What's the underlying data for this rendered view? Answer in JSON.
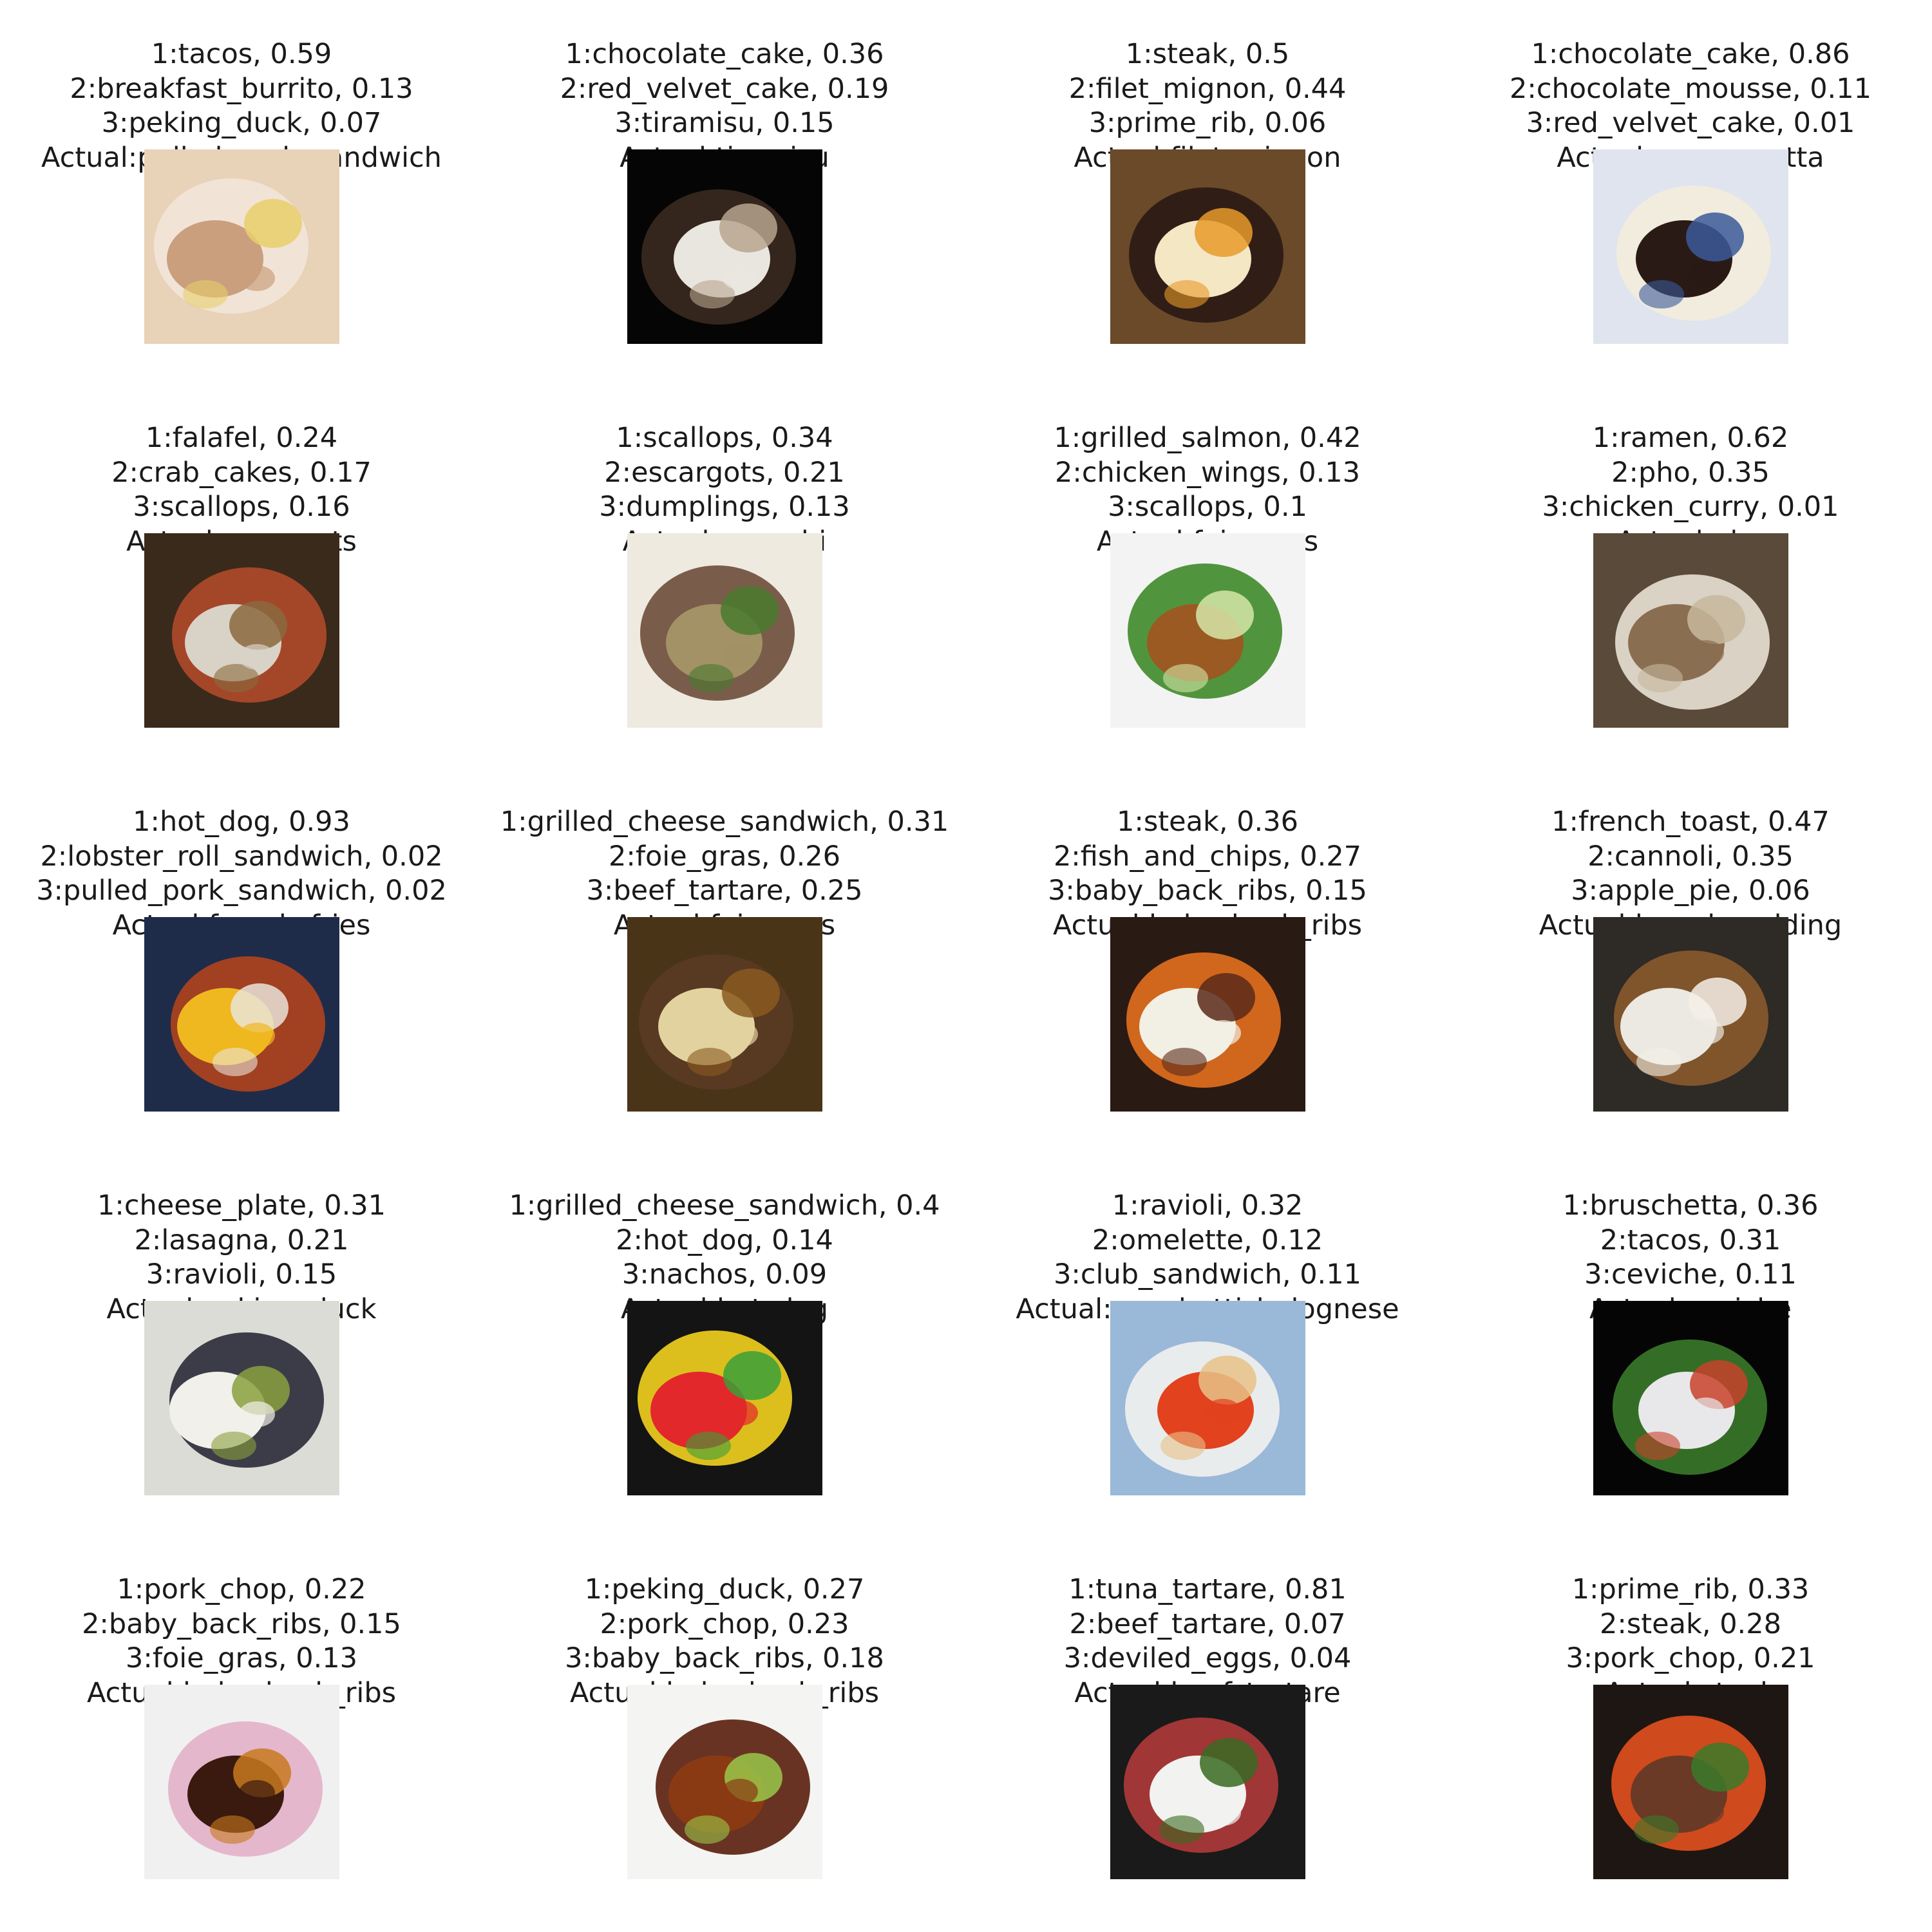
{
  "panels": [
    {
      "l1": "1:tacos, 0.59",
      "l2": "2:breakfast_burrito, 0.13",
      "l3": "3:peking_duck, 0.07",
      "actual": "Actual:pulled_pork_sandwich",
      "photo": "pulled-pork-photo",
      "bg": "#e8d2b8",
      "c1": "#c99f7e",
      "c2": "#f2e6d9",
      "c3": "#e8cf6a"
    },
    {
      "l1": "1:chocolate_cake, 0.36",
      "l2": "2:red_velvet_cake, 0.19",
      "l3": "3:tiramisu, 0.15",
      "actual": "Actual:tiramisu",
      "photo": "tiramisu-photo",
      "bg": "#050505",
      "c1": "#e9e6e0",
      "c2": "#3a2a20",
      "c3": "#b9a58e"
    },
    {
      "l1": "1:steak, 0.5",
      "l2": "2:filet_mignon, 0.44",
      "l3": "3:prime_rib, 0.06",
      "actual": "Actual:filet_mignon",
      "photo": "filet-mignon-photo",
      "bg": "#6b4a2a",
      "c1": "#f4e7c4",
      "c2": "#2a1a14",
      "c3": "#e89a2a"
    },
    {
      "l1": "1:chocolate_cake, 0.86",
      "l2": "2:chocolate_mousse, 0.11",
      "l3": "3:red_velvet_cake, 0.01",
      "actual": "Actual:panna_cotta",
      "photo": "panna-cotta-photo",
      "bg": "#dfe4ee",
      "c1": "#2a1a16",
      "c2": "#f3ecdc",
      "c3": "#3b5a9a"
    },
    {
      "l1": "1:falafel, 0.24",
      "l2": "2:crab_cakes, 0.17",
      "l3": "3:scallops, 0.16",
      "actual": "Actual:escargots",
      "photo": "escargots-photo",
      "bg": "#3a2a1c",
      "c1": "#d9d2c6",
      "c2": "#b04a2a",
      "c3": "#8a6a3e"
    },
    {
      "l1": "1:scallops, 0.34",
      "l2": "2:escargots, 0.21",
      "l3": "3:dumplings, 0.13",
      "actual": "Actual:gnocchi",
      "photo": "gnocchi-photo",
      "bg": "#efeae0",
      "c1": "#a39266",
      "c2": "#6b4e3a",
      "c3": "#4a7a2e"
    },
    {
      "l1": "1:grilled_salmon, 0.42",
      "l2": "2:chicken_wings, 0.13",
      "l3": "3:scallops, 0.1",
      "actual": "Actual:foie_gras",
      "photo": "foie-gras-photo",
      "bg": "#f3f3f3",
      "c1": "#9a5a22",
      "c2": "#3f8a2a",
      "c3": "#d6e6a8"
    },
    {
      "l1": "1:ramen, 0.62",
      "l2": "2:pho, 0.35",
      "l3": "3:chicken_curry, 0.01",
      "actual": "Actual:pho",
      "photo": "pho-photo",
      "bg": "#5a4a3a",
      "c1": "#8a6e52",
      "c2": "#e8e1d4",
      "c3": "#c7b89c"
    },
    {
      "l1": "1:hot_dog, 0.93",
      "l2": "2:lobster_roll_sandwich, 0.02",
      "l3": "3:pulled_pork_sandwich, 0.02",
      "actual": "Actual:french_fries",
      "photo": "french-fries-photo",
      "bg": "#1e2c4a",
      "c1": "#f0b820",
      "c2": "#b0421e",
      "c3": "#e9e4d8"
    },
    {
      "l1": "1:grilled_cheese_sandwich, 0.31",
      "l2": "2:foie_gras, 0.26",
      "l3": "3:beef_tartare, 0.25",
      "actual": "Actual:foie_gras",
      "photo": "foie-gras-photo-2",
      "bg": "#4a3418",
      "c1": "#e2d2a0",
      "c2": "#5a3a22",
      "c3": "#8a5a20"
    },
    {
      "l1": "1:steak, 0.36",
      "l2": "2:fish_and_chips, 0.27",
      "l3": "3:baby_back_ribs, 0.15",
      "actual": "Actual:baby_back_ribs",
      "photo": "baby-back-ribs-photo",
      "bg": "#2a1a14",
      "c1": "#f2efe4",
      "c2": "#e2701e",
      "c3": "#5a2a1a"
    },
    {
      "l1": "1:french_toast, 0.47",
      "l2": "2:cannoli, 0.35",
      "l3": "3:apple_pie, 0.06",
      "actual": "Actual:bread_pudding",
      "photo": "bread-pudding-photo",
      "bg": "#2e2a26",
      "c1": "#ece8e2",
      "c2": "#8a5a2e",
      "c3": "#f4f0e8"
    },
    {
      "l1": "1:cheese_plate, 0.31",
      "l2": "2:lasagna, 0.21",
      "l3": "3:ravioli, 0.15",
      "actual": "Actual:peking_duck",
      "photo": "peking-duck-photo",
      "bg": "#dcdcd6",
      "c1": "#f2f0ea",
      "c2": "#2a2a3a",
      "c3": "#8aa03e"
    },
    {
      "l1": "1:grilled_cheese_sandwich, 0.4",
      "l2": "2:hot_dog, 0.14",
      "l3": "3:nachos, 0.09",
      "actual": "Actual:hot_dog",
      "photo": "hot-dog-photo",
      "bg": "#141414",
      "c1": "#e2282a",
      "c2": "#f2d21e",
      "c3": "#3aa03a"
    },
    {
      "l1": "1:ravioli, 0.32",
      "l2": "2:omelette, 0.12",
      "l3": "3:club_sandwich, 0.11",
      "actual": "Actual:spaghetti_bolognese",
      "photo": "spaghetti-bolognese-photo",
      "bg": "#9ab8d8",
      "c1": "#e2421e",
      "c2": "#f2f2ee",
      "c3": "#e8c288"
    },
    {
      "l1": "1:bruschetta, 0.36",
      "l2": "2:tacos, 0.31",
      "l3": "3:ceviche, 0.11",
      "actual": "Actual:ceviche",
      "photo": "ceviche-photo",
      "bg": "#050505",
      "c1": "#e8e8ea",
      "c2": "#3a7a2a",
      "c3": "#c8422a"
    },
    {
      "l1": "1:pork_chop, 0.22",
      "l2": "2:baby_back_ribs, 0.15",
      "l3": "3:foie_gras, 0.13",
      "actual": "Actual:baby_back_ribs",
      "photo": "baby-back-ribs-photo-2",
      "bg": "#f0f0f0",
      "c1": "#3a1a0e",
      "c2": "#e2b0c8",
      "c3": "#c87a1e"
    },
    {
      "l1": "1:peking_duck, 0.27",
      "l2": "2:pork_chop, 0.23",
      "l3": "3:baby_back_ribs, 0.18",
      "actual": "Actual:baby_back_ribs",
      "photo": "baby-back-ribs-photo-3",
      "bg": "#f4f4f2",
      "c1": "#8a3a12",
      "c2": "#5a1e0c",
      "c3": "#9ac84a"
    },
    {
      "l1": "1:tuna_tartare, 0.81",
      "l2": "2:beef_tartare, 0.07",
      "l3": "3:deviled_eggs, 0.04",
      "actual": "Actual:beef_tartare",
      "photo": "beef-tartare-photo",
      "bg": "#1a1a1a",
      "c1": "#f2f2f0",
      "c2": "#b03a3a",
      "c3": "#3a6a22"
    },
    {
      "l1": "1:prime_rib, 0.33",
      "l2": "2:steak, 0.28",
      "l3": "3:pork_chop, 0.21",
      "actual": "Actual:steak",
      "photo": "steak-photo",
      "bg": "#1e1612",
      "c1": "#6a3a26",
      "c2": "#e2501e",
      "c3": "#3a7a2a"
    }
  ]
}
